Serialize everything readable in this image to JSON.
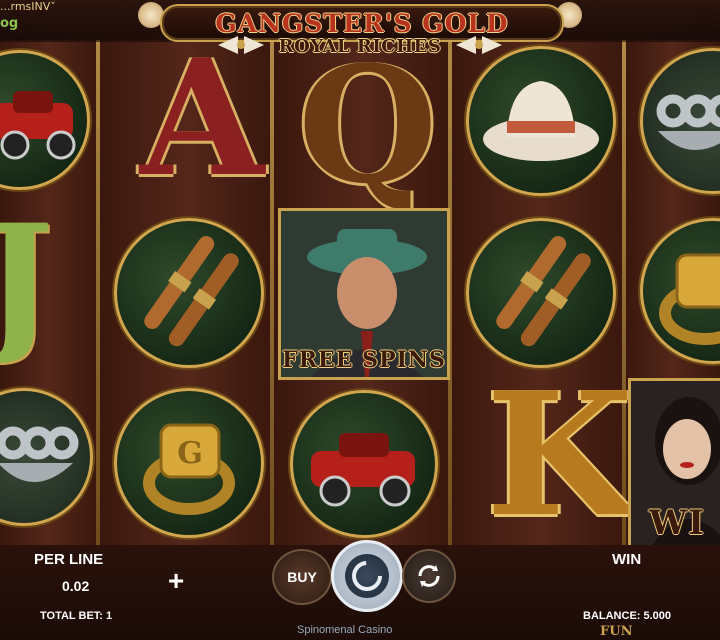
{
  "header": {
    "brand_top": "...rmsINV˅",
    "brand_sub": "og",
    "title": "GANGSTER'S GOLD",
    "subtitle": "ROYAL RICHES"
  },
  "reels": {
    "free_spins_label": "FREE SPINS",
    "wild_label": "WI",
    "letters": {
      "a": "A",
      "q": "Q",
      "j": "J",
      "k": "K"
    }
  },
  "controls": {
    "per_line_label": "PER LINE",
    "per_line_value": "0.02",
    "total_bet_label": "TOTAL BET: 1",
    "buy_label": "BUY",
    "win_label": "WIN",
    "balance_label": "BALANCE: 5.000",
    "mode_label": "FUN",
    "provider_label": "Spinomenal Casino"
  },
  "colors": {
    "gold": "#c9a24e",
    "reel_bg": "#4a2216",
    "accent_red": "#b8331f"
  }
}
